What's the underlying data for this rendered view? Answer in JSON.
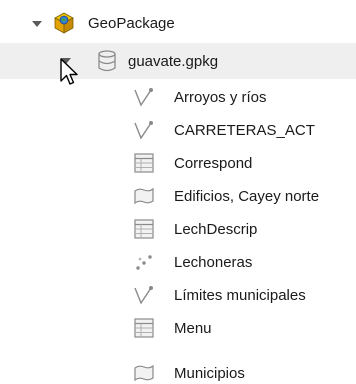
{
  "tree": {
    "root": {
      "label": "GeoPackage",
      "icon": "geopackage-icon",
      "expanded": true
    },
    "file": {
      "label": "guavate.gpkg",
      "icon": "database-icon",
      "expanded": true,
      "selected": true
    },
    "layers": [
      {
        "label": "Arroyos y ríos",
        "icon": "line-layer-icon"
      },
      {
        "label": "CARRETERAS_ACT",
        "icon": "line-layer-icon"
      },
      {
        "label": "Correspond",
        "icon": "table-icon"
      },
      {
        "label": "Edificios, Cayey norte",
        "icon": "polygon-layer-icon"
      },
      {
        "label": "LechDescrip",
        "icon": "table-icon"
      },
      {
        "label": "Lechoneras",
        "icon": "point-layer-icon"
      },
      {
        "label": "Límites municipales",
        "icon": "line-layer-icon"
      },
      {
        "label": "Menu",
        "icon": "table-icon"
      },
      {
        "label": "Municipios",
        "icon": "polygon-layer-icon"
      }
    ]
  },
  "colors": {
    "selection": "#efefef",
    "icon_gray": "#8a8a8a",
    "geopackage_yellow": "#f5c400",
    "geopackage_blue": "#3a7bd5"
  }
}
